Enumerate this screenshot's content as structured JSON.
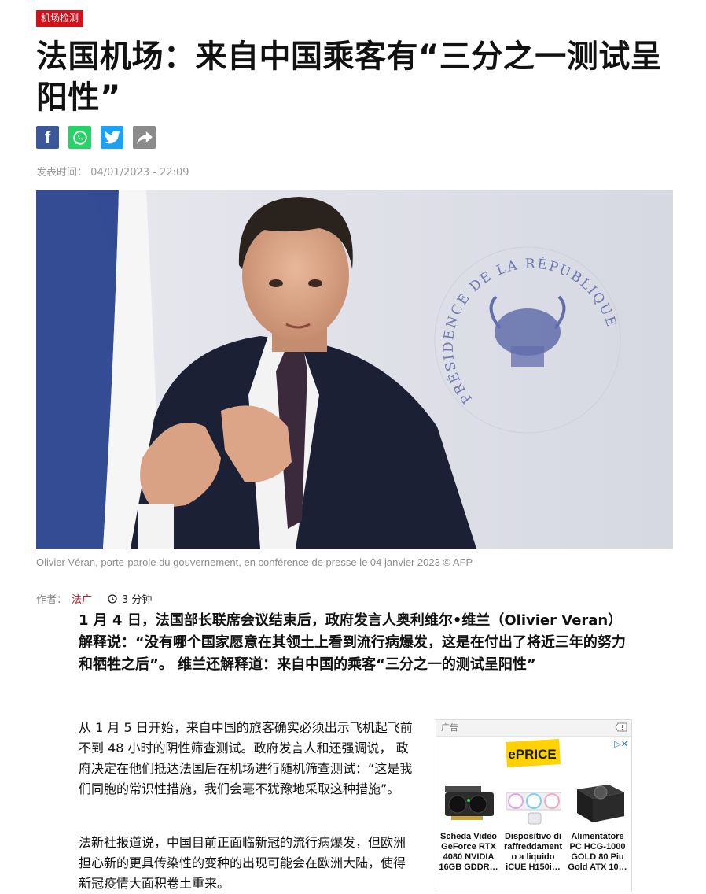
{
  "article": {
    "tag": "机场检测",
    "title": "法国机场：来自中国乘客有“三分之一测试呈阳性”",
    "date_label": "发表时间：",
    "date_value": "04/01/2023 - 22:09",
    "caption": "Olivier Véran, porte-parole du gouvernement, en conférence de presse le 04 janvier 2023 © AFP",
    "author_label": "作者：",
    "author": "法广",
    "read_time": "3 分钟",
    "lead": "1 月 4 日，法国部长联席会议结束后，政府发言人奥利维尔•维兰（Olivier Veran）解释说：“没有哪个国家愿意在其领土上看到流行病爆发，这是在付出了将近三年的努力和牺牲之后”。 维兰还解释道：来自中国的乘客“三分之一的测试呈阳性”",
    "paragraph1": "从 1 月 5 日开始，来自中国的旅客确实必须出示飞机起飞前不到 48 小时的阴性筛查测试。政府发言人和还强调说， 政府决定在他们抵达法国后在机场进行随机筛查测试：“这是我们同胞的常识性措施，我们会毫不犹豫地采取这种措施”。",
    "paragraph2": "法新社报道说，中国目前正面临新冠的流行病爆发，但欧洲担心新的更具传染性的变种的出现可能会在欧洲大陆，使得新冠疫情大面积卷土重来。"
  },
  "share": {
    "icons": [
      "facebook-icon",
      "whatsapp-icon",
      "twitter-icon",
      "share-icon"
    ],
    "colors": {
      "facebook": "#3b5998",
      "whatsapp": "#25d366",
      "twitter": "#1da1f2",
      "share": "#8b8b8b"
    }
  },
  "hero_image": {
    "seal_text": "PRÉSIDENCE DE LA RÉPUBLIQUE"
  },
  "ad": {
    "label": "广告",
    "brand": "ePRICE",
    "products": [
      {
        "name": "Scheda Video GeForce RTX 4080 NVIDIA 16GB GDDR…"
      },
      {
        "name": "Dispositivo di raffreddament o a liquido iCUE H150i…"
      },
      {
        "name": "Alimentatore PC HCG-1000 GOLD 80 Piu Gold ATX 10…"
      }
    ]
  },
  "colors": {
    "accent": "#d2111c",
    "muted": "#999999"
  }
}
